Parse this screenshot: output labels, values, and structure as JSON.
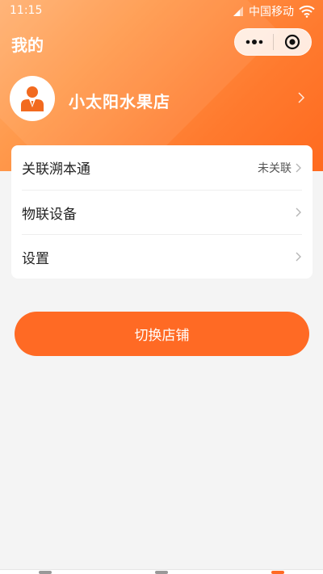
{
  "status_bar": {
    "time": "11:15",
    "carrier": "中国移动"
  },
  "nav": {
    "title": "我的"
  },
  "profile": {
    "store_name": "小太阳水果店"
  },
  "menu": {
    "items": [
      {
        "label": "关联溯本通",
        "value": "未关联"
      },
      {
        "label": "物联设备",
        "value": ""
      },
      {
        "label": "设置",
        "value": ""
      }
    ]
  },
  "actions": {
    "switch_store_label": "切换店铺"
  },
  "colors": {
    "brand_orange": "#ff6a24",
    "header_gradient_start": "#ffb070",
    "header_gradient_end": "#ff6a1f"
  }
}
